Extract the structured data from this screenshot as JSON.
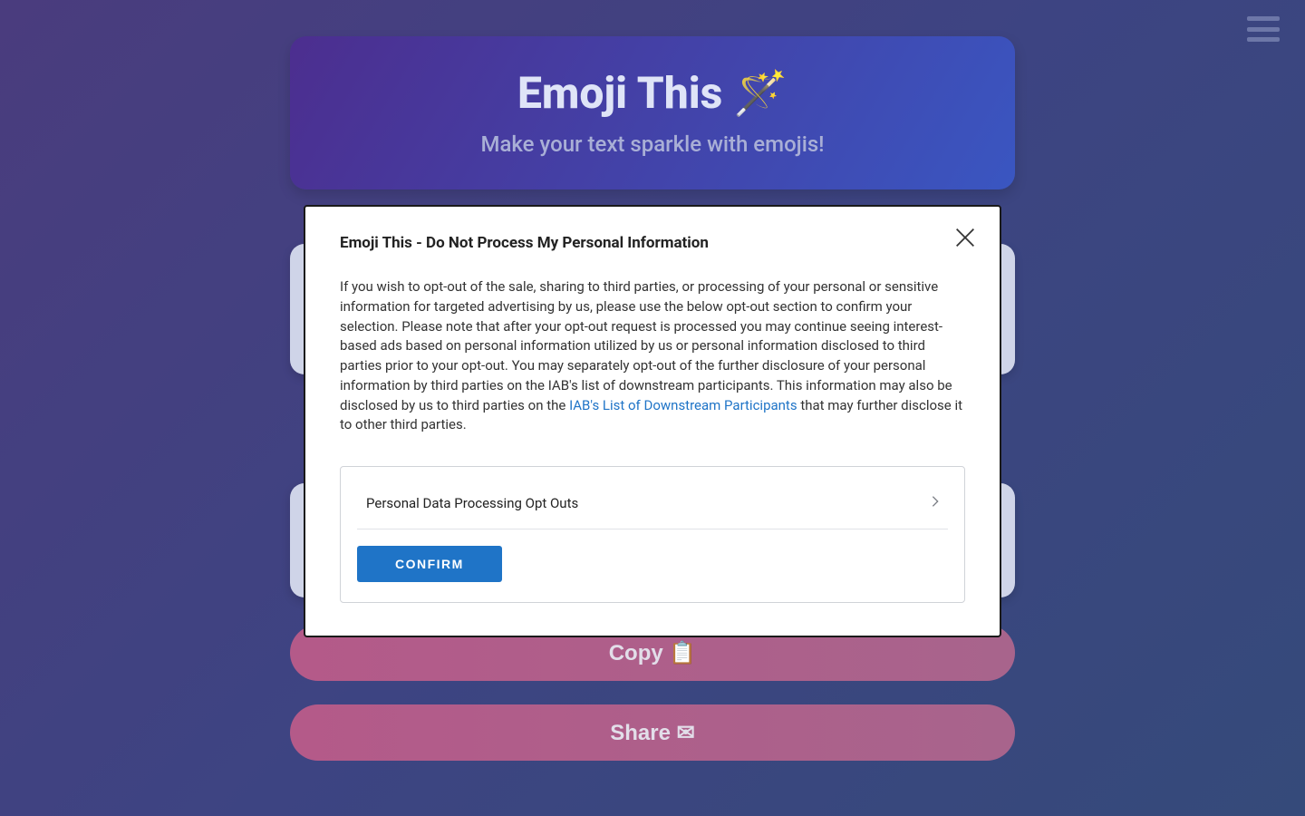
{
  "header": {
    "title": "Emoji This 🪄",
    "subtitle": "Make your text sparkle with emojis!"
  },
  "buttons": {
    "copy": "Copy 📋",
    "share": "Share ✉"
  },
  "modal": {
    "title": "Emoji This - Do Not Process My Personal Information",
    "body_part1": "If you wish to opt-out of the sale, sharing to third parties, or processing of your personal or sensitive information for targeted advertising by us, please use the below opt-out section to confirm your selection. Please note that after your opt-out request is processed you may continue seeing interest-based ads based on personal information utilized by us or personal information disclosed to third parties prior to your opt-out. You may separately opt-out of the further disclosure of your personal information by third parties on the IAB's list of downstream participants. This information may also be disclosed by us to third parties on the ",
    "link_text": "IAB's List of Downstream Participants",
    "body_part2": " that may further disclose it to other third parties.",
    "opt_out_row": "Personal Data Processing Opt Outs",
    "confirm_button": "CONFIRM"
  }
}
